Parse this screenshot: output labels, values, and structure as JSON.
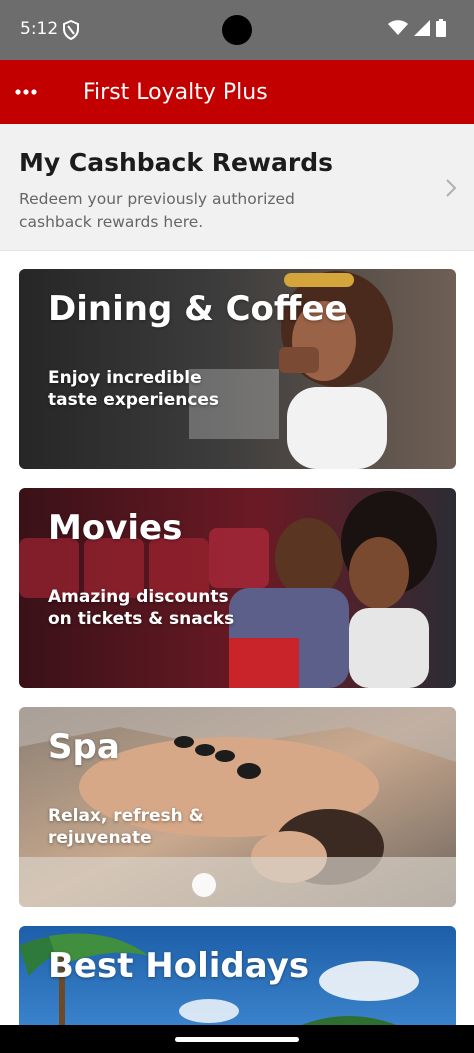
{
  "status_bar": {
    "time": "5:12",
    "icons": [
      "shield-icon",
      "wifi-icon",
      "signal-icon",
      "battery-icon"
    ]
  },
  "app_bar": {
    "menu_icon": "more-horizontal-icon",
    "title": "First Loyalty Plus",
    "color": "#c20000"
  },
  "cashback": {
    "title": "My Cashback Rewards",
    "description": "Redeem your previously authorized cashback rewards here.",
    "icon": "chevron-right-icon"
  },
  "cards": [
    {
      "title": "Dining & Coffee",
      "subtitle": "Enjoy incredible taste experiences"
    },
    {
      "title": "Movies",
      "subtitle": "Amazing discounts on tickets & snacks"
    },
    {
      "title": "Spa",
      "subtitle": "Relax, refresh & rejuvenate"
    },
    {
      "title": "Best Holidays",
      "subtitle": ""
    }
  ]
}
